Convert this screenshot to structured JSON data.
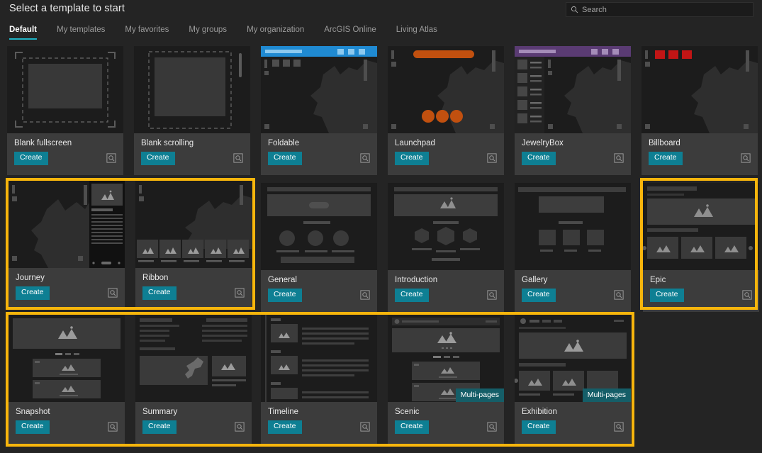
{
  "header": {
    "title": "Select a template to start",
    "search": {
      "placeholder": "Search",
      "icon": "search-icon"
    }
  },
  "tabs": [
    {
      "label": "Default",
      "active": true
    },
    {
      "label": "My templates",
      "active": false
    },
    {
      "label": "My favorites",
      "active": false
    },
    {
      "label": "My groups",
      "active": false
    },
    {
      "label": "My organization",
      "active": false
    },
    {
      "label": "ArcGIS Online",
      "active": false
    },
    {
      "label": "Living Atlas",
      "active": false
    }
  ],
  "labels": {
    "create": "Create",
    "preview_icon": "preview-magnifier-icon",
    "multipages_badge": "Multi-pages"
  },
  "colors": {
    "background": "#242424",
    "card_label": "#3c3c3c",
    "thumb": "#1c1c1c",
    "accent_teal": "#0e7f93",
    "tab_underline": "#1fb3c4",
    "highlight_yellow": "#f7b50c",
    "badge_teal": "#155e68",
    "foldable_header_blue": "#1f8ad2",
    "launchpad_orange": "#c1500f",
    "jewelrybox_purple": "#5a3b73",
    "billboard_red": "#c11515"
  },
  "cards": [
    {
      "name": "blank-fullscreen",
      "title": "Blank fullscreen",
      "create": "Create",
      "badge": null,
      "highlighted": false
    },
    {
      "name": "blank-scrolling",
      "title": "Blank scrolling",
      "create": "Create",
      "badge": null,
      "highlighted": false
    },
    {
      "name": "foldable",
      "title": "Foldable",
      "create": "Create",
      "badge": null,
      "highlighted": false
    },
    {
      "name": "launchpad",
      "title": "Launchpad",
      "create": "Create",
      "badge": null,
      "highlighted": false
    },
    {
      "name": "jewelrybox",
      "title": "JewelryBox",
      "create": "Create",
      "badge": null,
      "highlighted": false
    },
    {
      "name": "billboard",
      "title": "Billboard",
      "create": "Create",
      "badge": null,
      "highlighted": false
    },
    {
      "name": "journey",
      "title": "Journey",
      "create": "Create",
      "badge": null,
      "highlighted": true
    },
    {
      "name": "ribbon",
      "title": "Ribbon",
      "create": "Create",
      "badge": null,
      "highlighted": true
    },
    {
      "name": "general",
      "title": "General",
      "create": "Create",
      "badge": null,
      "highlighted": false
    },
    {
      "name": "introduction",
      "title": "Introduction",
      "create": "Create",
      "badge": null,
      "highlighted": false
    },
    {
      "name": "gallery",
      "title": "Gallery",
      "create": "Create",
      "badge": null,
      "highlighted": false
    },
    {
      "name": "epic",
      "title": "Epic",
      "create": "Create",
      "badge": null,
      "highlighted": true
    },
    {
      "name": "snapshot",
      "title": "Snapshot",
      "create": "Create",
      "badge": null,
      "highlighted": true
    },
    {
      "name": "summary",
      "title": "Summary",
      "create": "Create",
      "badge": null,
      "highlighted": true
    },
    {
      "name": "timeline",
      "title": "Timeline",
      "create": "Create",
      "badge": null,
      "highlighted": true
    },
    {
      "name": "scenic",
      "title": "Scenic",
      "create": "Create",
      "badge": "Multi-pages",
      "highlighted": true
    },
    {
      "name": "exhibition",
      "title": "Exhibition",
      "create": "Create",
      "badge": "Multi-pages",
      "highlighted": true
    }
  ]
}
